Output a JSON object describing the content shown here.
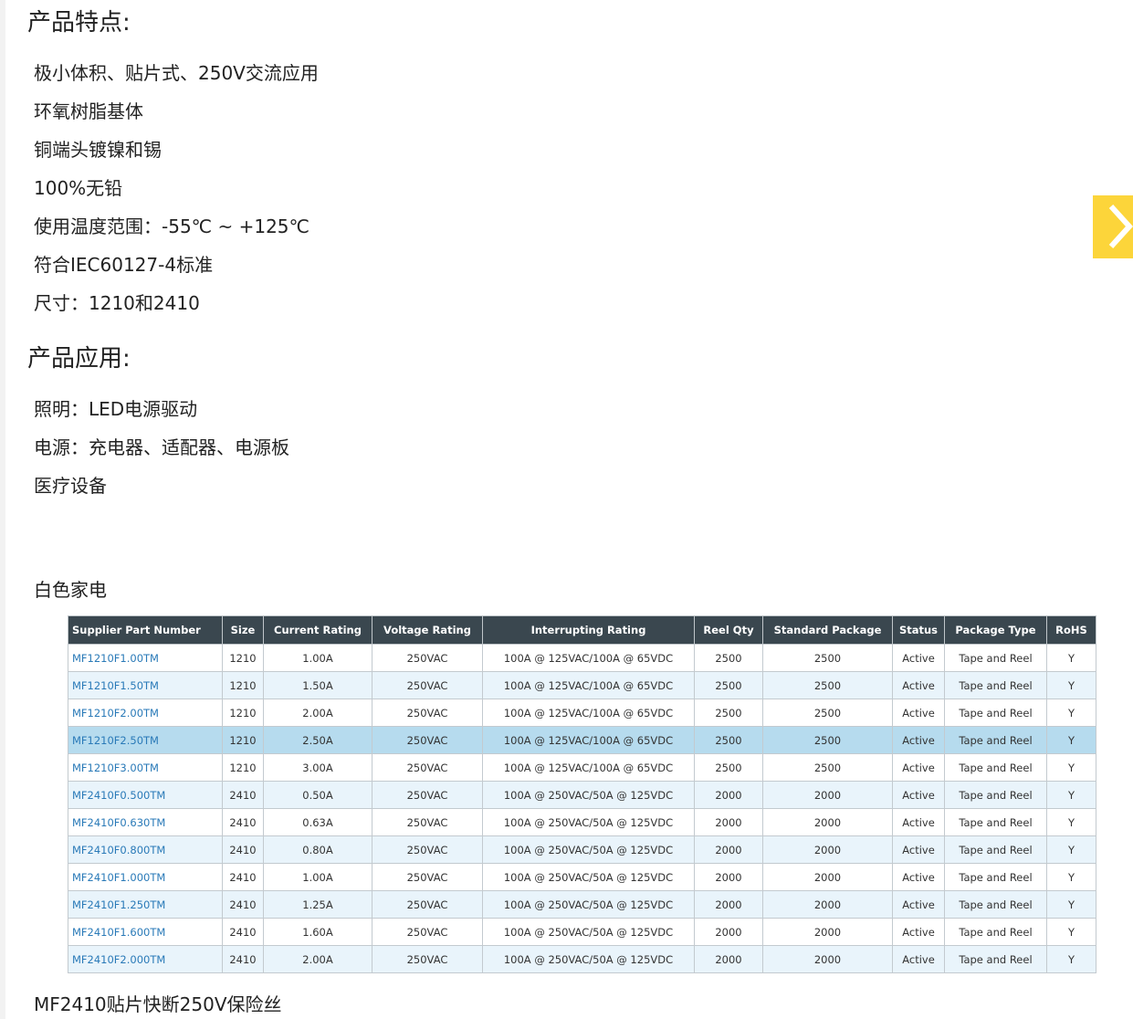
{
  "features": {
    "title": "产品特点:",
    "items": [
      "极小体积、贴片式、250V交流应用",
      "环氧树脂基体",
      "铜端头镀镍和锡",
      "100%无铅",
      "使用温度范围：-55℃ ~ +125℃",
      "符合IEC60127-4标准",
      "尺寸：1210和2410"
    ]
  },
  "applications": {
    "title": "产品应用:",
    "items": [
      "照明：LED电源驱动",
      "电源：充电器、适配器、电源板",
      "医疗设备"
    ],
    "extra": "白色家电"
  },
  "carousel": {
    "next_icon": "chevron-right-icon",
    "color": "#fcd53a"
  },
  "table": {
    "headers": [
      "Supplier Part Number",
      "Size",
      "Current Rating",
      "Voltage Rating",
      "Interrupting Rating",
      "Reel Qty",
      "Standard Package",
      "Status",
      "Package Type",
      "RoHS"
    ],
    "highlight_row": 3,
    "rows": [
      [
        "MF1210F1.00TM",
        "1210",
        "1.00A",
        "250VAC",
        "100A @ 125VAC/100A @ 65VDC",
        "2500",
        "2500",
        "Active",
        "Tape and Reel",
        "Y"
      ],
      [
        "MF1210F1.50TM",
        "1210",
        "1.50A",
        "250VAC",
        "100A @ 125VAC/100A @ 65VDC",
        "2500",
        "2500",
        "Active",
        "Tape and Reel",
        "Y"
      ],
      [
        "MF1210F2.00TM",
        "1210",
        "2.00A",
        "250VAC",
        "100A @ 125VAC/100A @ 65VDC",
        "2500",
        "2500",
        "Active",
        "Tape and Reel",
        "Y"
      ],
      [
        "MF1210F2.50TM",
        "1210",
        "2.50A",
        "250VAC",
        "100A @ 125VAC/100A @ 65VDC",
        "2500",
        "2500",
        "Active",
        "Tape and Reel",
        "Y"
      ],
      [
        "MF1210F3.00TM",
        "1210",
        "3.00A",
        "250VAC",
        "100A @ 125VAC/100A @ 65VDC",
        "2500",
        "2500",
        "Active",
        "Tape and Reel",
        "Y"
      ],
      [
        "MF2410F0.500TM",
        "2410",
        "0.50A",
        "250VAC",
        "100A @ 250VAC/50A @ 125VDC",
        "2000",
        "2000",
        "Active",
        "Tape and Reel",
        "Y"
      ],
      [
        "MF2410F0.630TM",
        "2410",
        "0.63A",
        "250VAC",
        "100A @ 250VAC/50A @ 125VDC",
        "2000",
        "2000",
        "Active",
        "Tape and Reel",
        "Y"
      ],
      [
        "MF2410F0.800TM",
        "2410",
        "0.80A",
        "250VAC",
        "100A @ 250VAC/50A @ 125VDC",
        "2000",
        "2000",
        "Active",
        "Tape and Reel",
        "Y"
      ],
      [
        "MF2410F1.000TM",
        "2410",
        "1.00A",
        "250VAC",
        "100A @ 250VAC/50A @ 125VDC",
        "2000",
        "2000",
        "Active",
        "Tape and Reel",
        "Y"
      ],
      [
        "MF2410F1.250TM",
        "2410",
        "1.25A",
        "250VAC",
        "100A @ 250VAC/50A @ 125VDC",
        "2000",
        "2000",
        "Active",
        "Tape and Reel",
        "Y"
      ],
      [
        "MF2410F1.600TM",
        "2410",
        "1.60A",
        "250VAC",
        "100A @ 250VAC/50A @ 125VDC",
        "2000",
        "2000",
        "Active",
        "Tape and Reel",
        "Y"
      ],
      [
        "MF2410F2.000TM",
        "2410",
        "2.00A",
        "250VAC",
        "100A @ 250VAC/50A @ 125VDC",
        "2000",
        "2000",
        "Active",
        "Tape and Reel",
        "Y"
      ]
    ]
  },
  "caption": "MF2410贴片快断250V保险丝"
}
